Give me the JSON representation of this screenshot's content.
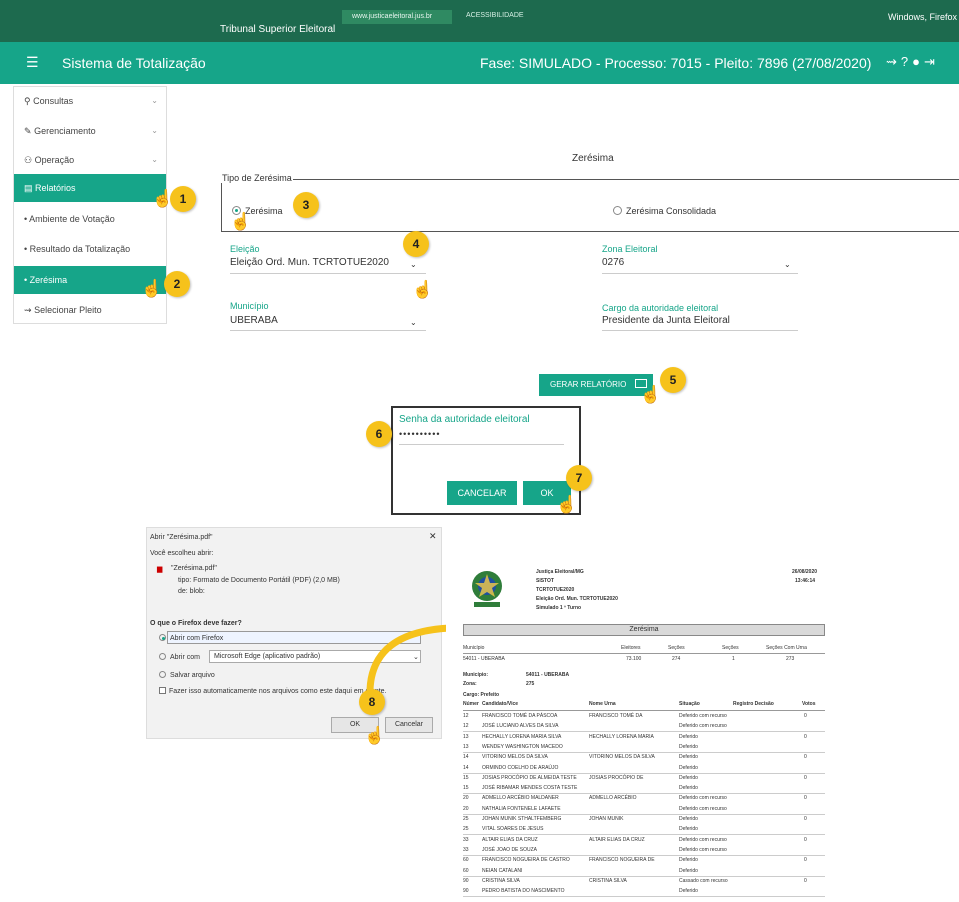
{
  "top_header": {
    "org": "Tribunal Superior Eleitoral",
    "url": "www.justicaeleitoral.jus.br",
    "accessibility": "ACESSIBILIDADE",
    "window_title": "Windows, Firefox"
  },
  "app_bar": {
    "title": "Sistema de Totalização",
    "status": "Fase: SIMULADO - Processo: 7015 - Pleito: 7896 (27/08/2020)"
  },
  "sidebar": {
    "items": [
      {
        "label": "Consultas"
      },
      {
        "label": "Gerenciamento"
      },
      {
        "label": "Operação"
      },
      {
        "label": "Relatórios"
      },
      {
        "label": "Ambiente de Votação"
      },
      {
        "label": "Resultado da Totalização"
      },
      {
        "label": "Zerésima"
      },
      {
        "label": "Selecionar Pleito"
      }
    ]
  },
  "form": {
    "title": "Zerésima",
    "tipo_legend": "Tipo de Zerésima",
    "radio_zeresima": "Zerésima",
    "radio_consolidada": "Zerésima Consolidada",
    "eleicao_label": "Eleição",
    "eleicao_value": "Eleição Ord. Mun. TCRTOTUE2020",
    "zona_label": "Zona Eleitoral",
    "zona_value": "0276",
    "municipio_label": "Município",
    "municipio_value": "UBERABA",
    "cargo_label": "Cargo da autoridade eleitoral",
    "cargo_value": "Presidente da Junta Eleitoral",
    "gerar_button": "GERAR RELATÓRIO"
  },
  "auth_dialog": {
    "label": "Senha da autoridade eleitoral",
    "password": "••••••••••",
    "cancel": "CANCELAR",
    "ok": "OK"
  },
  "markers": [
    "1",
    "2",
    "3",
    "4",
    "5",
    "6",
    "7",
    "8"
  ],
  "firefox_dialog": {
    "title": "Abrir \"Zerésima.pdf\"",
    "intro": "Você escolheu abrir:",
    "filename": "\"Zerésima.pdf\"",
    "type_line": "tipo: Formato de Documento Portátil (PDF) (2,0 MB)",
    "from_line": "de: blob:",
    "question": "O que o Firefox deve fazer?",
    "opt_firefox": "Abrir com Firefox",
    "opt_open_with": "Abrir com",
    "opt_open_with_app": "Microsoft Edge (aplicativo padrão)",
    "opt_save": "Salvar arquivo",
    "auto_check": "Fazer isso automaticamente nos arquivos como este daqui em diante.",
    "ok": "OK",
    "cancel": "Cancelar",
    "close": "✕"
  },
  "pdf": {
    "header_lines": [
      "Justiça Eleitoral/MG",
      "SISTOT",
      "TCRTOTUE2020",
      "Eleição Ord. Mun. TCRTOTUE2020",
      "Simulado 1 º Turno"
    ],
    "date": "26/08/2020",
    "time": "13:46:14",
    "band_title": "Zerésima",
    "summary_headers": [
      "Município",
      "Eleitores",
      "Seções",
      "Seções",
      "Seções Com Urna"
    ],
    "summary_row": [
      "54011 - UBERABA",
      "73.100",
      "274",
      "1",
      "273"
    ],
    "municipio_label": "Município:",
    "municipio_value": "54011 - UBERABA",
    "zona_label": "Zona:",
    "zona_value": "275",
    "cargo_label": "Cargo: Prefeito",
    "table_headers": [
      "Númer",
      "Candidato/Vice",
      "Nome Urna",
      "Situação",
      "Registro Decisão",
      "Votos"
    ],
    "rows": [
      [
        "12",
        "FRANCISCO TOMÉ DA PÁSCOA",
        "FRANCISCO TOMÉ DA",
        "Deferido com recurso",
        "0"
      ],
      [
        "12",
        "JOSÉ LUCIANO ALVES DA SILVA",
        "",
        "Deferido com recurso",
        ""
      ],
      [
        "13",
        "HECHALLY LORENA MARIA SILVA",
        "HECHALLY LORENA MARIA",
        "Deferido",
        "0"
      ],
      [
        "13",
        "WENDEY WASHINGTON MACEDO",
        "",
        "Deferido",
        ""
      ],
      [
        "14",
        "VITORINO MELOS DA SILVA",
        "VITORINO MELOS DA SILVA",
        "Deferido",
        "0"
      ],
      [
        "14",
        "ORMINDO COELHO DE ARAÚJO",
        "",
        "Deferido",
        ""
      ],
      [
        "15",
        "JOSIAS PROCÓPIO DE ALMEIDA TESTE",
        "JOSIAS PROCÓPIO DE",
        "Deferido",
        "0"
      ],
      [
        "15",
        "JOSÉ RIBAMAR MENDES COSTA TESTE",
        "",
        "Deferido",
        ""
      ],
      [
        "20",
        "ADMELLO ARCÉBIO MALDANER",
        "ADMELLO ARCÉBIO",
        "Deferido com recurso",
        "0"
      ],
      [
        "20",
        "NATHALIA FONTENELE LAFAETE",
        "",
        "Deferido com recurso",
        ""
      ],
      [
        "25",
        "JOHAN MUNIK STHALTFEMBERG",
        "JOHAN MUNIK",
        "Deferido",
        "0"
      ],
      [
        "25",
        "VITAL SOARES DE JESUS",
        "",
        "Deferido",
        ""
      ],
      [
        "33",
        "ALTAIR ELIAS DA CRUZ",
        "ALTAIR ELIAS DA CRUZ",
        "Deferido com recurso",
        "0"
      ],
      [
        "33",
        "JOSÉ JOAO DE SOUZA",
        "",
        "Deferido com recurso",
        ""
      ],
      [
        "60",
        "FRANCISCO NOGUEIRA DE CASTRO",
        "FRANCISCO NOGUEIRA DE",
        "Deferido",
        "0"
      ],
      [
        "60",
        "NEIAN CATALANI",
        "",
        "Deferido",
        ""
      ],
      [
        "90",
        "CRISTINA SILVA",
        "CRISTINA SILVA",
        "Cassado com recurso",
        "0"
      ],
      [
        "90",
        "PEDRO BATISTA DO NASCIMENTO",
        "",
        "Deferido",
        ""
      ]
    ]
  }
}
